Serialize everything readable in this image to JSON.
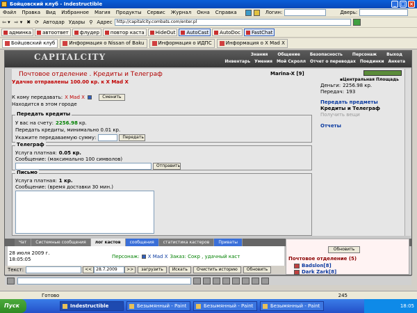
{
  "window": {
    "title": "Бойцовский клуб - Indestructible"
  },
  "menu": {
    "items": [
      "Файл",
      "Правка",
      "Вид",
      "Избранное",
      "Магия",
      "Продукты",
      "Сервис",
      "Журнал",
      "Окна",
      "Справка"
    ],
    "login_label": "Логин:",
    "doors_label": "Дверь:"
  },
  "toolbar": {
    "autodar": "Автодар",
    "udar": "Удары",
    "address_label": "Адрес",
    "url": "http://capitalcity.combats.com/enter.pl"
  },
  "links": {
    "items": [
      "админка",
      "автоответ",
      "флудер",
      "повтор каста",
      "HideOut",
      "AutoCast",
      "AutoDoc",
      "FastChat"
    ]
  },
  "tabs": {
    "items": [
      "Бойцовский клуб",
      "Информация о Nissan of Baku",
      "Информация о ИДПС",
      "Информация о X Mad X"
    ]
  },
  "game": {
    "logo": "CAPITALCITY",
    "nav_top": [
      "Знания",
      "Общение",
      "Безопасность",
      "Персонаж",
      "Выход"
    ],
    "nav_bottom": [
      "Инвентарь",
      "Умения",
      "Мой Скролл",
      "Отчет о переводах",
      "Поединки",
      "Анкета"
    ],
    "page_title": "Почтовое отделение .  Кредиты и Телеграф",
    "player": "Marina-X [9]",
    "success": "Удачно отправлены 100.00 кр. к X Mad X",
    "recipient_label": "К кому передавать:",
    "recipient": "X Mad X",
    "change_btn": "Сменить",
    "location_note": "Находится в этом городе",
    "credits": {
      "legend": "Передать кредиты",
      "balance_label": "У вас на счету:",
      "balance": "2256.98",
      "balance_unit": "кр.",
      "min_note": "Передать кредиты, минимально 0.01 кр.",
      "sum_label": "Укажите передаваемую сумму:",
      "send_btn": "Передать"
    },
    "telegraph": {
      "legend": "Телеграф",
      "paid_label": "Услуга платная:",
      "paid_value": "0.05 кр.",
      "msg_label": "Сообщение: (максимально 100 символов)",
      "send_btn": "Отправить"
    },
    "letter": {
      "legend": "Письмо",
      "paid_label": "Услуга платная:",
      "paid_value": "1 кр.",
      "msg_label": "Сообщение: (время доставки 30 мин.)"
    },
    "sidebar": {
      "location": "Центральная Площадь",
      "money_label": "Деньги:",
      "money": "2256.98 кр.",
      "transfers_label": "Передач:",
      "transfers": "193",
      "link1": "Передать предметы",
      "current": "Кредиты и Телеграф",
      "disabled": "Получить вещи",
      "reports": "Отчеты"
    },
    "chat": {
      "tabs": [
        "Чат",
        "Системные сообщения",
        "лог кастов",
        "сообщения",
        "статистика кастеров",
        "Приваты"
      ],
      "date_line": "28 июля 2009 г.",
      "time_line": "18:05:05",
      "msg_prefix": "Персонаж:",
      "msg_name": "X Mad X",
      "msg_text": "Заказ: Сокр , удачный каст",
      "text_label": "Текст:",
      "date_value": "28.7.2009",
      "btn_load": "загрузить",
      "btn_search": "Искать",
      "btn_clear": "Очистить историю",
      "btn_refresh": "Обновить"
    },
    "online": {
      "refresh": "Обновить",
      "place": "Почтовое отделение (5)",
      "users": [
        "Badslon[8]",
        "Dark Zark[8]"
      ]
    }
  },
  "statusbar": {
    "text": "Готово",
    "count": "245"
  },
  "taskbar": {
    "start": "Пуск",
    "tasks": [
      "Indestructible",
      "Безымянный - Paint",
      "Безымянный - Paint",
      "Безымянный - Paint"
    ],
    "time": "18:05"
  }
}
